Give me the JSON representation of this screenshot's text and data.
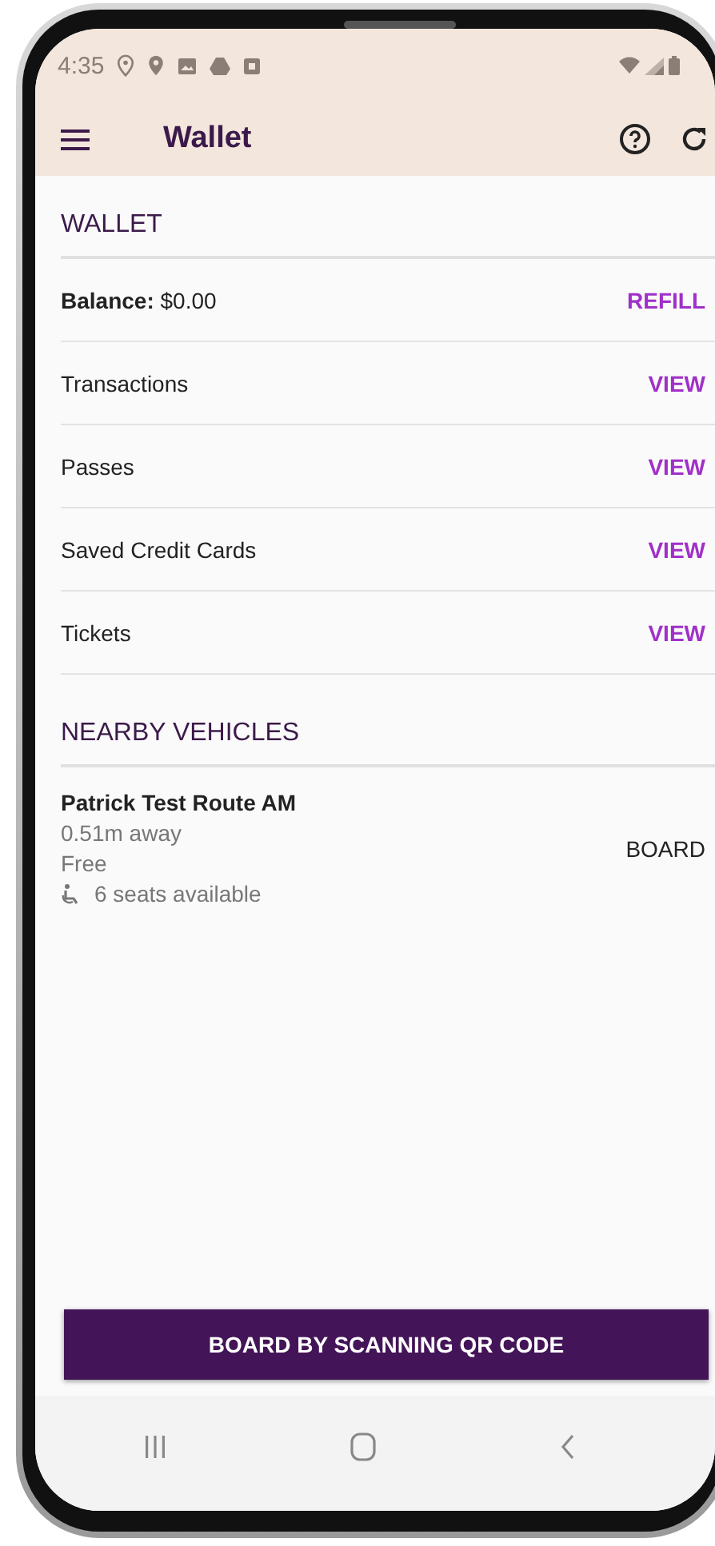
{
  "status_bar": {
    "time": "4:35"
  },
  "app_bar": {
    "title": "Wallet"
  },
  "wallet": {
    "heading": "WALLET",
    "rows": [
      {
        "label": "**Balance:** $0.00",
        "action": "REFILL"
      },
      {
        "label": "Transactions",
        "action": "VIEW"
      },
      {
        "label": "Passes",
        "action": "VIEW"
      },
      {
        "label": "Saved Credit Cards",
        "action": "VIEW"
      },
      {
        "label": "Tickets",
        "action": "VIEW"
      }
    ]
  },
  "nearby": {
    "heading": "NEARBY VEHICLES",
    "vehicles": [
      {
        "name": "Patrick Test Route AM",
        "distance": "0.51m away",
        "fare": "Free",
        "seats": "6 seats available",
        "action": "BOARD"
      }
    ]
  },
  "primary_button": "BOARD BY SCANNING QR CODE"
}
